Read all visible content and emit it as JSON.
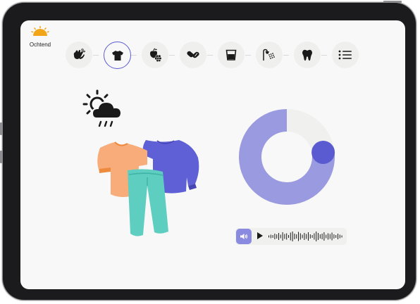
{
  "header": {
    "time_of_day_label": "Ochtend",
    "time_of_day_icon": "sunrise-icon"
  },
  "steps": [
    {
      "name": "wash-hands-icon",
      "active": false
    },
    {
      "name": "tshirt-icon",
      "active": true
    },
    {
      "name": "fruit-icon",
      "active": false
    },
    {
      "name": "pills-icon",
      "active": false
    },
    {
      "name": "glass-icon",
      "active": false
    },
    {
      "name": "shower-icon",
      "active": false
    },
    {
      "name": "tooth-icon",
      "active": false
    },
    {
      "name": "menu-list-icon",
      "active": false
    }
  ],
  "main": {
    "illustration": "clothes-weather-illustration",
    "timer": {
      "progress_fraction": 0.77,
      "remaining_fraction": 0.23
    },
    "audio": {
      "volume_icon": "speaker-icon",
      "play_icon": "play-icon"
    }
  },
  "colors": {
    "accent": "#5a5bd0",
    "ring": "#9a9ae0",
    "ring_track": "#f0f0ee",
    "sun": "#f2a516"
  }
}
